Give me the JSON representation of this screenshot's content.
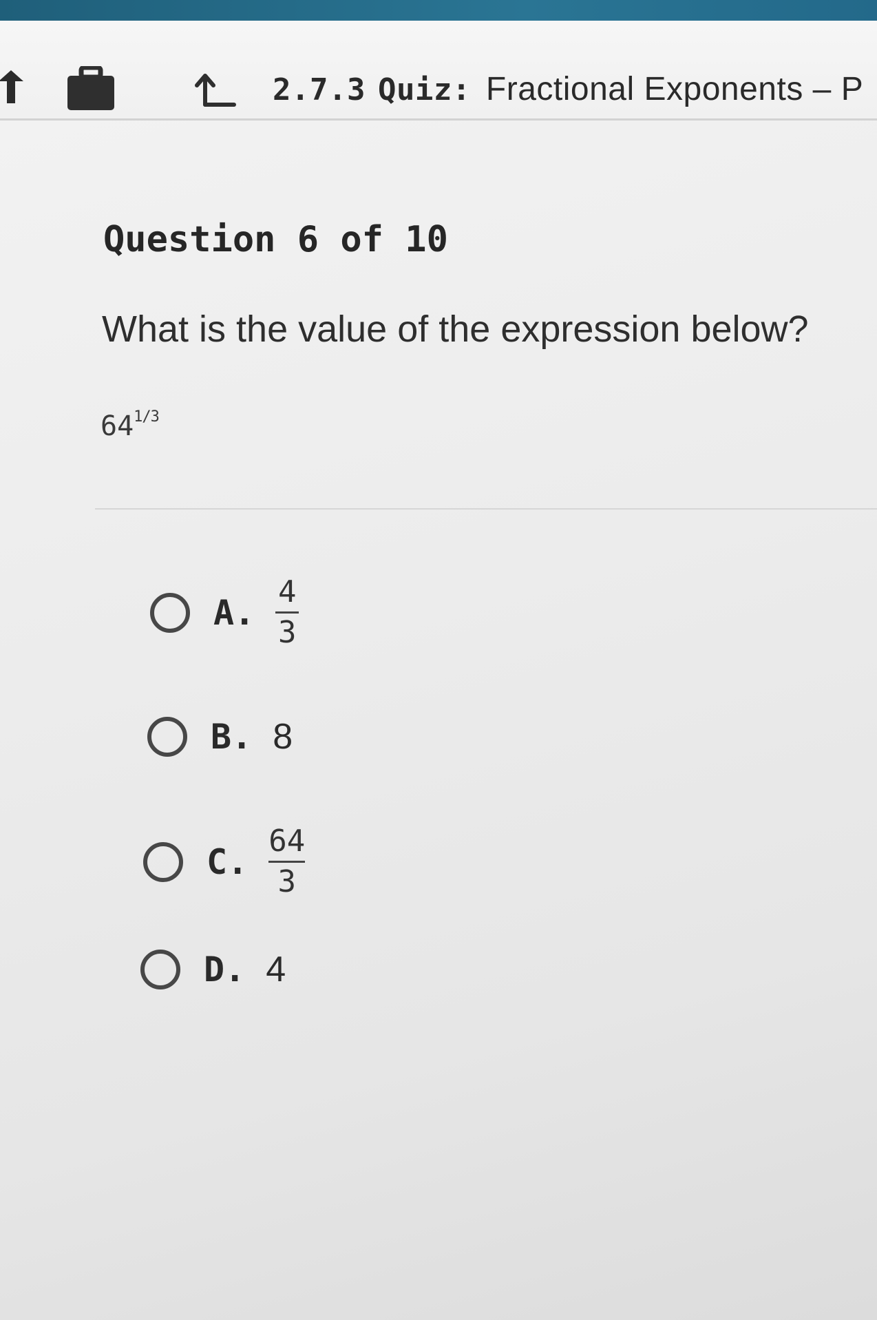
{
  "header": {
    "section_number": "2.7.3",
    "quiz_label": "Quiz:",
    "quiz_title": "Fractional Exponents – P"
  },
  "question": {
    "heading": "Question 6 of 10",
    "prompt": "What is the value of the expression below?",
    "expression_base": "64",
    "expression_exponent": "1/3"
  },
  "options": [
    {
      "letter": "A.",
      "numerator": "4",
      "denominator": "3"
    },
    {
      "letter": "B.",
      "value": "8"
    },
    {
      "letter": "C.",
      "numerator": "64",
      "denominator": "3"
    },
    {
      "letter": "D.",
      "value": "4"
    }
  ],
  "icons": {
    "back": "back-arrow-icon",
    "briefcase": "briefcase-icon",
    "upload": "upload-arrow-icon"
  },
  "colors": {
    "top_strip": "#2a7594",
    "radio_border": "#474747"
  }
}
